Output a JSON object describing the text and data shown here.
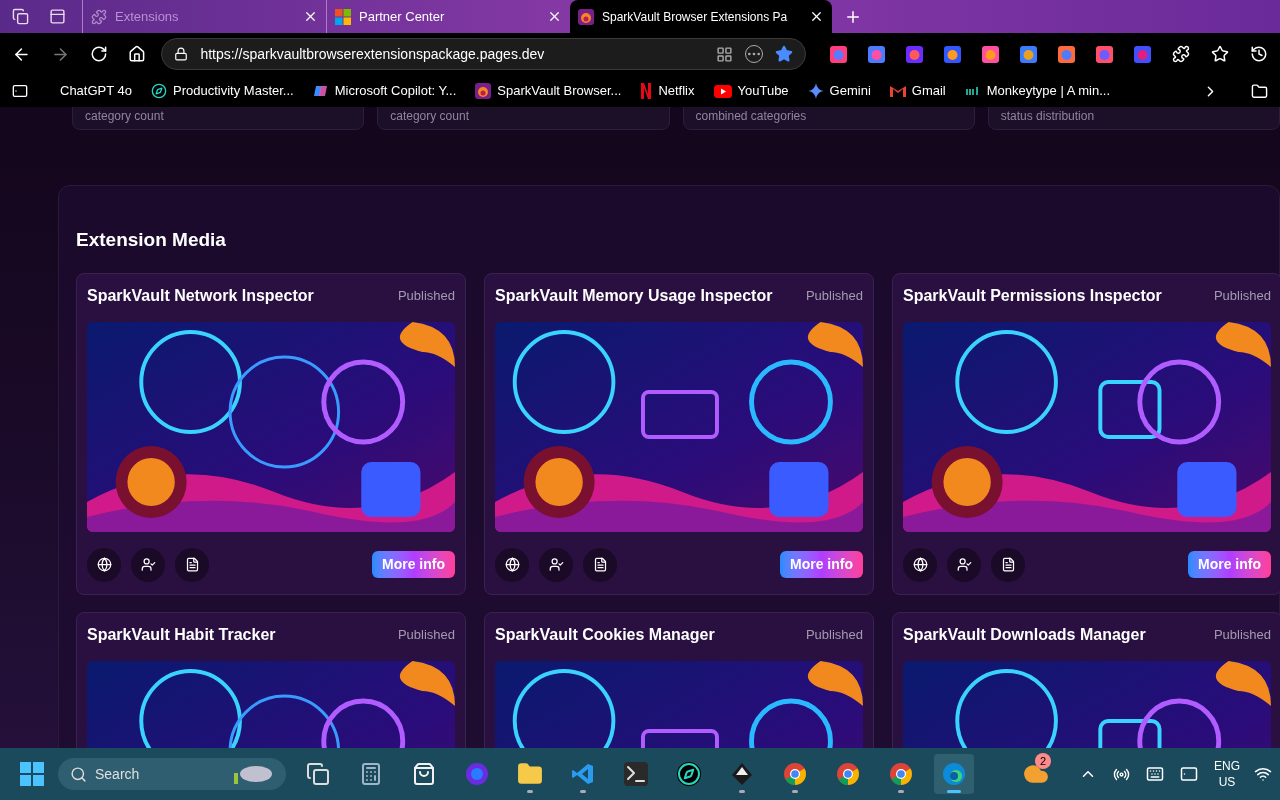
{
  "tabs": [
    {
      "title": "Extensions",
      "selected": false,
      "kind": "puzzle"
    },
    {
      "title": "Partner Center",
      "selected": false,
      "kind": "windows"
    },
    {
      "title": "SparkVault Browser Extensions Pa",
      "selected": true,
      "kind": "spark"
    }
  ],
  "address": {
    "url": "https://sparkvaultbrowserextensionspackage.pages.dev"
  },
  "bookmarks": [
    {
      "label": "ChatGPT 4o",
      "kind": "none"
    },
    {
      "label": "Productivity Master...",
      "kind": "compass"
    },
    {
      "label": "Microsoft Copilot: Y...",
      "kind": "copilot"
    },
    {
      "label": "SparkVault Browser...",
      "kind": "spark"
    },
    {
      "label": "Netflix",
      "kind": "netflix"
    },
    {
      "label": "YouTube",
      "kind": "youtube"
    },
    {
      "label": "Gemini",
      "kind": "gemini"
    },
    {
      "label": "Gmail",
      "kind": "gmail"
    },
    {
      "label": "Monkeytype | A min...",
      "kind": "mt"
    }
  ],
  "stat_cards": [
    {
      "caption": "category count"
    },
    {
      "caption": "category count"
    },
    {
      "caption": "combined categories"
    },
    {
      "caption": "status distribution"
    }
  ],
  "section": {
    "title": "Extension Media",
    "cards": [
      {
        "title": "SparkVault Network Inspector",
        "status": "Published",
        "button": "More info"
      },
      {
        "title": "SparkVault Memory Usage Inspector",
        "status": "Published",
        "button": "More info"
      },
      {
        "title": "SparkVault Permissions Inspector",
        "status": "Published",
        "button": "More info"
      },
      {
        "title": "SparkVault Habit Tracker",
        "status": "Published"
      },
      {
        "title": "SparkVault Cookies Manager",
        "status": "Published"
      },
      {
        "title": "SparkVault Downloads Manager",
        "status": "Published"
      }
    ]
  },
  "taskbar": {
    "search": {
      "placeholder": "Search"
    },
    "apps": [
      {
        "kind": "taskview",
        "running": false,
        "active": false
      },
      {
        "kind": "calculator",
        "running": false,
        "active": false
      },
      {
        "kind": "store",
        "running": false,
        "active": false
      },
      {
        "kind": "firefox",
        "running": false,
        "active": false
      },
      {
        "kind": "explorer",
        "running": true,
        "active": false
      },
      {
        "kind": "vscode",
        "running": true,
        "active": false
      },
      {
        "kind": "terminal",
        "running": false,
        "active": false
      },
      {
        "kind": "compass",
        "running": false,
        "active": false
      },
      {
        "kind": "inkscape",
        "running": true,
        "active": false
      },
      {
        "kind": "chrome",
        "running": true,
        "active": false
      },
      {
        "kind": "chrome",
        "running": false,
        "active": false
      },
      {
        "kind": "chrome",
        "running": true,
        "active": false
      },
      {
        "kind": "edge",
        "running": true,
        "active": true
      }
    ],
    "weather_badge": "2",
    "language": "ENG",
    "region": "US"
  }
}
